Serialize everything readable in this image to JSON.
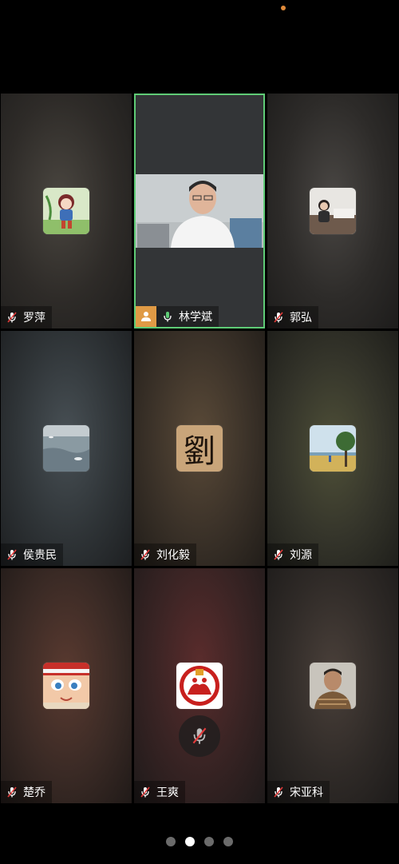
{
  "participants": [
    {
      "name": "罗萍"
    },
    {
      "name": "林学斌"
    },
    {
      "name": "郭弘"
    },
    {
      "name": "侯贵民"
    },
    {
      "name": "刘化毅"
    },
    {
      "name": "刘源"
    },
    {
      "name": "楚乔"
    },
    {
      "name": "王爽"
    },
    {
      "name": "宋亚科"
    }
  ],
  "avatar_glyphs": {
    "liu_huayi": "劉"
  },
  "pager": {
    "pages": 4,
    "active": 2
  },
  "colors": {
    "active_speaker_border": "#5fcc76",
    "host_badge": "#e09a45",
    "status_dot": "#e08a3a"
  }
}
